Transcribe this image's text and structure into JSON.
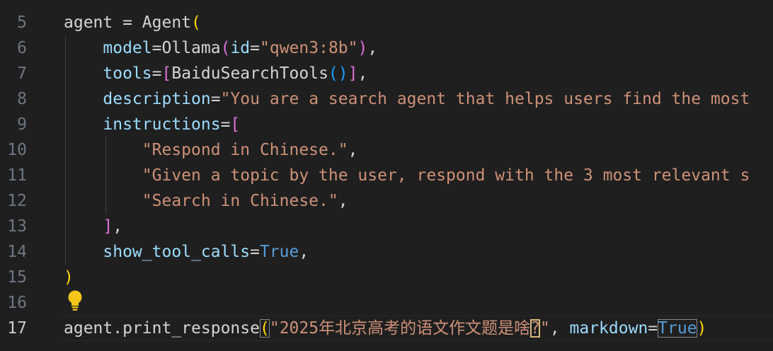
{
  "colors": {
    "background": "#1f1f1f",
    "line_number": "#6e7681",
    "current_line_number": "#cccccc",
    "variable": "#9cdcfe",
    "plain": "#d4d4d4",
    "string": "#ce9178",
    "function": "#dcdcaa",
    "constant": "#569cd6",
    "bracket_gold": "#ffd700",
    "bracket_pink": "#da70d6",
    "bracket_blue": "#179fff"
  },
  "icons": {
    "lightbulb": "lightbulb-icon"
  },
  "editor": {
    "current_line": "17",
    "lines": [
      {
        "num": "5",
        "tokens": [
          {
            "t": "agent = ",
            "c": "plain"
          },
          {
            "t": "Agent",
            "c": "plain"
          },
          {
            "t": "(",
            "c": "gold"
          }
        ]
      },
      {
        "num": "6",
        "tokens": [
          {
            "t": "    ",
            "c": "plain"
          },
          {
            "t": "model",
            "c": "var"
          },
          {
            "t": "=",
            "c": "plain"
          },
          {
            "t": "Ollama",
            "c": "plain"
          },
          {
            "t": "(",
            "c": "pink"
          },
          {
            "t": "id",
            "c": "var"
          },
          {
            "t": "=",
            "c": "plain"
          },
          {
            "t": "\"qwen3:8b\"",
            "c": "str"
          },
          {
            "t": ")",
            "c": "pink"
          },
          {
            "t": ",",
            "c": "plain"
          }
        ]
      },
      {
        "num": "7",
        "tokens": [
          {
            "t": "    ",
            "c": "plain"
          },
          {
            "t": "tools",
            "c": "var"
          },
          {
            "t": "=",
            "c": "plain"
          },
          {
            "t": "[",
            "c": "pink"
          },
          {
            "t": "BaiduSearchTools",
            "c": "plain"
          },
          {
            "t": "(",
            "c": "blue"
          },
          {
            "t": ")",
            "c": "blue"
          },
          {
            "t": "]",
            "c": "pink"
          },
          {
            "t": ",",
            "c": "plain"
          }
        ]
      },
      {
        "num": "8",
        "tokens": [
          {
            "t": "    ",
            "c": "plain"
          },
          {
            "t": "description",
            "c": "var"
          },
          {
            "t": "=",
            "c": "plain"
          },
          {
            "t": "\"You are a search agent that helps users find the most",
            "c": "str"
          }
        ]
      },
      {
        "num": "9",
        "tokens": [
          {
            "t": "    ",
            "c": "plain"
          },
          {
            "t": "instructions",
            "c": "var"
          },
          {
            "t": "=",
            "c": "plain"
          },
          {
            "t": "[",
            "c": "pink"
          }
        ]
      },
      {
        "num": "10",
        "tokens": [
          {
            "t": "        ",
            "c": "plain"
          },
          {
            "t": "\"Respond in Chinese.\"",
            "c": "str"
          },
          {
            "t": ",",
            "c": "plain"
          }
        ]
      },
      {
        "num": "11",
        "tokens": [
          {
            "t": "        ",
            "c": "plain"
          },
          {
            "t": "\"Given a topic by the user, respond with the 3 most relevant s",
            "c": "str"
          }
        ]
      },
      {
        "num": "12",
        "tokens": [
          {
            "t": "        ",
            "c": "plain"
          },
          {
            "t": "\"Search in Chinese.\"",
            "c": "str"
          },
          {
            "t": ",",
            "c": "plain"
          }
        ]
      },
      {
        "num": "13",
        "tokens": [
          {
            "t": "    ",
            "c": "plain"
          },
          {
            "t": "]",
            "c": "pink"
          },
          {
            "t": ",",
            "c": "plain"
          }
        ]
      },
      {
        "num": "14",
        "tokens": [
          {
            "t": "    ",
            "c": "plain"
          },
          {
            "t": "show_tool_calls",
            "c": "var"
          },
          {
            "t": "=",
            "c": "plain"
          },
          {
            "t": "True",
            "c": "const"
          },
          {
            "t": ",",
            "c": "plain"
          }
        ]
      },
      {
        "num": "15",
        "tokens": [
          {
            "t": ")",
            "c": "gold"
          }
        ]
      },
      {
        "num": "16",
        "tokens": []
      },
      {
        "num": "17",
        "tokens": [
          {
            "t": "agent",
            "c": "plain"
          },
          {
            "t": ".",
            "c": "plain"
          },
          {
            "t": "print_response",
            "c": "plain"
          },
          {
            "t": "(",
            "c": "gold",
            "box": "grey"
          },
          {
            "t": "\"2025年北京高考的语文作文题是啥",
            "c": "str"
          },
          {
            "t": "?",
            "c": "str",
            "box": "yellow"
          },
          {
            "t": "\"",
            "c": "str"
          },
          {
            "t": ", ",
            "c": "plain"
          },
          {
            "t": "markdown",
            "c": "var"
          },
          {
            "t": "=",
            "c": "plain"
          },
          {
            "t": "True",
            "c": "const",
            "box": "grey"
          },
          {
            "t": ")",
            "c": "gold"
          }
        ]
      }
    ]
  }
}
